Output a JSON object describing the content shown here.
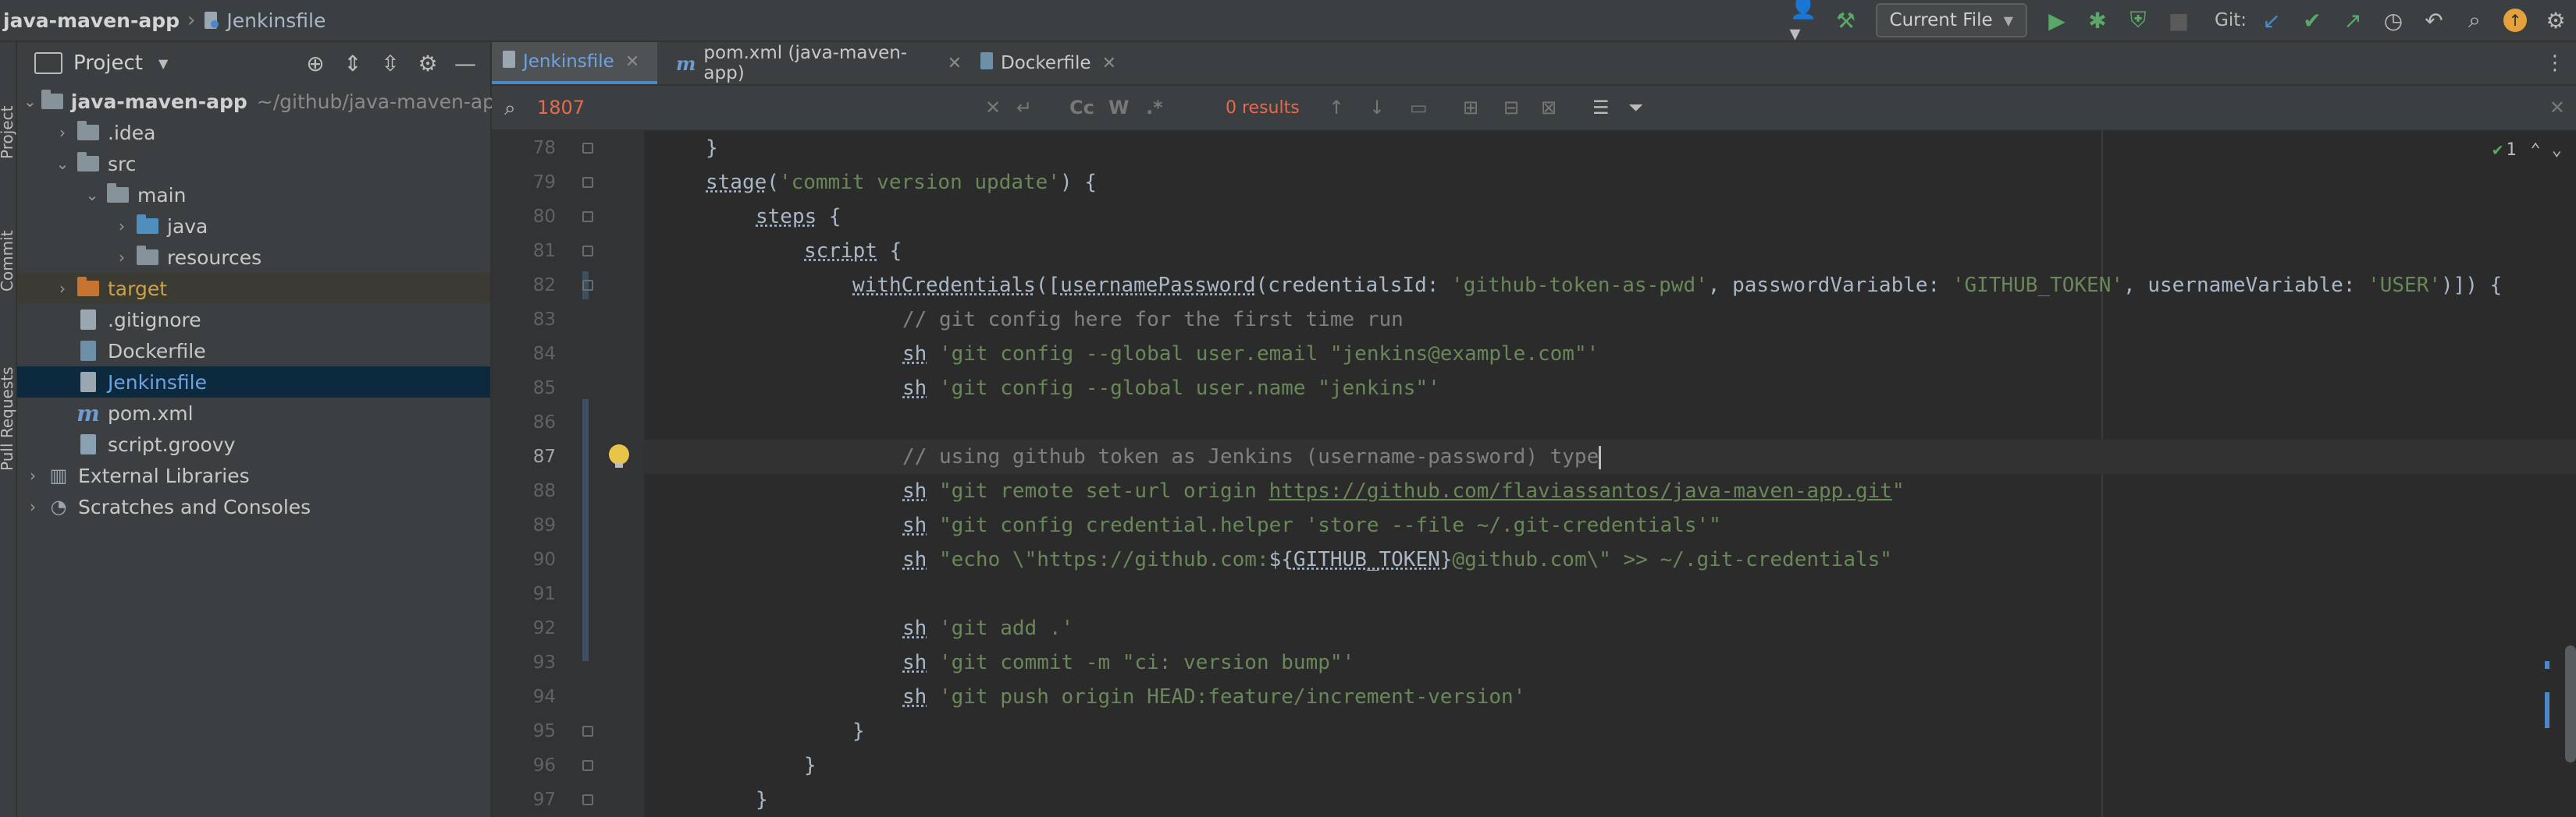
{
  "titlebar": {
    "project": "java-maven-app",
    "file": "Jenkinsfile",
    "run_config": "Current File",
    "git_label": "Git:"
  },
  "stripe": {
    "project": "Project",
    "commit": "Commit",
    "pull_requests": "Pull Requests"
  },
  "project_panel": {
    "title": "Project",
    "root": {
      "name": "java-maven-app",
      "path": "~/github/java-maven-app"
    },
    "items": [
      {
        "label": ".idea"
      },
      {
        "label": "src"
      },
      {
        "label": "main"
      },
      {
        "label": "java"
      },
      {
        "label": "resources"
      },
      {
        "label": "target"
      },
      {
        "label": ".gitignore"
      },
      {
        "label": "Dockerfile"
      },
      {
        "label": "Jenkinsfile"
      },
      {
        "label": "pom.xml"
      },
      {
        "label": "script.groovy"
      },
      {
        "label": "External Libraries"
      },
      {
        "label": "Scratches and Consoles"
      }
    ]
  },
  "tabs": [
    {
      "label": "Jenkinsfile",
      "active": true
    },
    {
      "label": "pom.xml (java-maven-app)",
      "active": false
    },
    {
      "label": "Dockerfile",
      "active": false
    }
  ],
  "find": {
    "query": "1807",
    "results": "0 results",
    "opt_case": "Cc",
    "opt_word": "W",
    "opt_regex": ".*"
  },
  "inspections": {
    "count": "1"
  },
  "editor": {
    "line_numbers": [
      "78",
      "79",
      "80",
      "81",
      "82",
      "83",
      "84",
      "85",
      "86",
      "87",
      "88",
      "89",
      "90",
      "91",
      "92",
      "93",
      "94",
      "95",
      "96",
      "97"
    ],
    "current_line": "87",
    "lines": {
      "l78": "}",
      "l79_stage": "stage",
      "l79_str": "'commit version update'",
      "l79_rest": ") {",
      "l80_steps": "steps",
      "l80_rest": " {",
      "l81_script": "script",
      "l81_rest": " {",
      "l82_with": "withCredentials",
      "l82_a": "([",
      "l82_up": "usernamePassword",
      "l82_b": "(",
      "l82_p1": "credentialsId",
      "l82_c": ": ",
      "l82_s1": "'github-token-as-pwd'",
      "l82_d": ", ",
      "l82_p2": "passwordVariable",
      "l82_e": ": ",
      "l82_s2": "'GITHUB_TOKEN'",
      "l82_f": ", ",
      "l82_p3": "usernameVariable",
      "l82_g": ": ",
      "l82_s3": "'USER'",
      "l82_h": ")]) {",
      "l83": "// git config here for the first time run",
      "l84_sh": "sh",
      "l84_str": "'git config --global user.email \"jenkins@example.com\"'",
      "l85_sh": "sh",
      "l85_str": "'git config --global user.name \"jenkins\"'",
      "l87": "// using github token as Jenkins (username-password) type",
      "l88_sh": "sh",
      "l88_a": "\"git remote set-url origin ",
      "l88_url": "https://github.com/flaviassantos/java-maven-app.git",
      "l88_b": "\"",
      "l89_sh": "sh",
      "l89_str": "\"git config credential.helper 'store --file ~/.git-credentials'\"",
      "l90_sh": "sh",
      "l90_a": "\"echo \\\"https://github.com:",
      "l90_var1": "${",
      "l90_var": "GITHUB_TOKEN",
      "l90_var2": "}",
      "l90_b": "@github.com\\\" >> ~/.git-credentials\"",
      "l92_sh": "sh",
      "l92_str": "'git add .'",
      "l93_sh": "sh",
      "l93_str": "'git commit -m \"ci: version bump\"'",
      "l94_sh": "sh",
      "l94_str": "'git push origin HEAD:feature/increment-version'",
      "l95": "}",
      "l96": "}",
      "l97": "}"
    }
  },
  "colors": {
    "accent": "#4a88c7",
    "string": "#6a8759",
    "comment": "#808080",
    "search_error": "#e86a4d"
  }
}
